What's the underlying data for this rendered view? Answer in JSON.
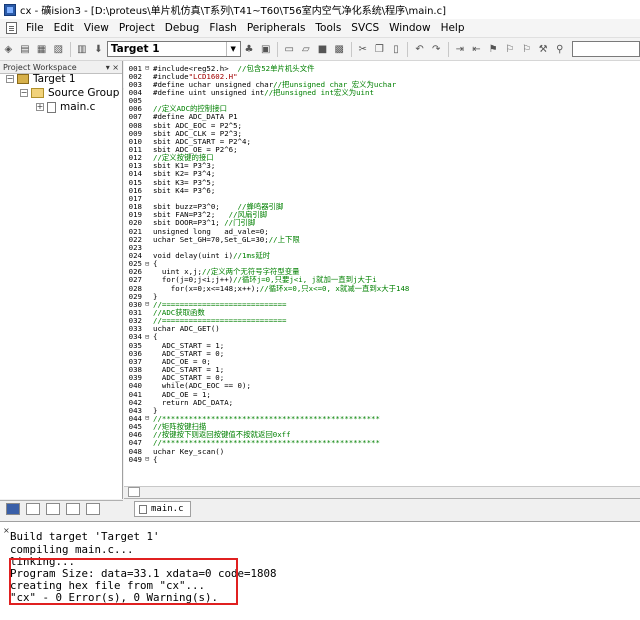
{
  "window": {
    "title": "cx - 礦ision3 - [D:\\proteus\\单片机仿真\\T系列\\T41~T60\\T56室内空气净化系统\\程序\\main.c]"
  },
  "menu": [
    "File",
    "Edit",
    "View",
    "Project",
    "Debug",
    "Flash",
    "Peripherals",
    "Tools",
    "SVCS",
    "Window",
    "Help"
  ],
  "toolbar": {
    "target": "Target 1"
  },
  "project_panel": {
    "header": "Project Workspace",
    "header_controls": "▾ ×",
    "tree": {
      "target": "Target 1",
      "group": "Source Group 1",
      "file": "main.c"
    }
  },
  "editor": {
    "tab": "main.c",
    "lines": [
      {
        "n": "001",
        "f": "⊟",
        "parts": [
          [
            "code",
            "#include<reg52.h>  "
          ],
          [
            "cmt",
            "//包含52单片机头文件"
          ]
        ]
      },
      {
        "n": "002",
        "f": "",
        "parts": [
          [
            "code",
            "#include"
          ],
          [
            "str",
            "\"LCD1602.H\""
          ]
        ]
      },
      {
        "n": "003",
        "f": "",
        "parts": [
          [
            "code",
            "#define uchar unsigned char"
          ],
          [
            "cmt",
            "//把unsigned char 宏义为uchar"
          ]
        ]
      },
      {
        "n": "004",
        "f": "",
        "parts": [
          [
            "code",
            "#define uint unsigned int"
          ],
          [
            "cmt",
            "//把unsigned int宏义为uint"
          ]
        ]
      },
      {
        "n": "005",
        "f": "",
        "parts": [
          [
            "code",
            ""
          ]
        ]
      },
      {
        "n": "006",
        "f": "",
        "parts": [
          [
            "cmt",
            "//定义ADC的控制接口"
          ]
        ]
      },
      {
        "n": "007",
        "f": "",
        "parts": [
          [
            "code",
            "#define ADC_DATA P1"
          ]
        ]
      },
      {
        "n": "008",
        "f": "",
        "parts": [
          [
            "code",
            "sbit ADC_EOC = P2^5;"
          ]
        ]
      },
      {
        "n": "009",
        "f": "",
        "parts": [
          [
            "code",
            "sbit ADC_CLK = P2^3;"
          ]
        ]
      },
      {
        "n": "010",
        "f": "",
        "parts": [
          [
            "code",
            "sbit ADC_START = P2^4;"
          ]
        ]
      },
      {
        "n": "011",
        "f": "",
        "parts": [
          [
            "code",
            "sbit ADC_OE = P2^6;"
          ]
        ]
      },
      {
        "n": "012",
        "f": "",
        "parts": [
          [
            "cmt",
            "//定义按键的接口"
          ]
        ]
      },
      {
        "n": "013",
        "f": "",
        "parts": [
          [
            "code",
            "sbit K1= P3^3;"
          ]
        ]
      },
      {
        "n": "014",
        "f": "",
        "parts": [
          [
            "code",
            "sbit K2= P3^4;"
          ]
        ]
      },
      {
        "n": "015",
        "f": "",
        "parts": [
          [
            "code",
            "sbit K3= P3^5;"
          ]
        ]
      },
      {
        "n": "016",
        "f": "",
        "parts": [
          [
            "code",
            "sbit K4= P3^6;"
          ]
        ]
      },
      {
        "n": "017",
        "f": "",
        "parts": [
          [
            "code",
            ""
          ]
        ]
      },
      {
        "n": "018",
        "f": "",
        "parts": [
          [
            "code",
            "sbit buzz=P3^0;    "
          ],
          [
            "cmt",
            "//蜂鸣器引脚"
          ]
        ]
      },
      {
        "n": "019",
        "f": "",
        "parts": [
          [
            "code",
            "sbit FAN=P3^2;   "
          ],
          [
            "cmt",
            "//风扇引脚"
          ]
        ]
      },
      {
        "n": "020",
        "f": "",
        "parts": [
          [
            "code",
            "sbit DOOR=P3^1; "
          ],
          [
            "cmt",
            "//门引脚"
          ]
        ]
      },
      {
        "n": "021",
        "f": "",
        "parts": [
          [
            "code",
            "unsigned long   ad_vale=0;"
          ]
        ]
      },
      {
        "n": "022",
        "f": "",
        "parts": [
          [
            "code",
            "uchar Set_GH=70,Set_GL=30;"
          ],
          [
            "cmt",
            "//上下限"
          ]
        ]
      },
      {
        "n": "023",
        "f": "",
        "parts": [
          [
            "code",
            ""
          ]
        ]
      },
      {
        "n": "024",
        "f": "",
        "parts": [
          [
            "code",
            "void delay(uint i)"
          ],
          [
            "cmt",
            "//1ms延时"
          ]
        ]
      },
      {
        "n": "025",
        "f": "⊟",
        "parts": [
          [
            "code",
            "{"
          ]
        ]
      },
      {
        "n": "026",
        "f": "",
        "parts": [
          [
            "code",
            "  uint x,j;"
          ],
          [
            "cmt",
            "//定义两个无符号字符型变量"
          ]
        ]
      },
      {
        "n": "027",
        "f": "",
        "parts": [
          [
            "code",
            "  for(j=0;j<i;j++)"
          ],
          [
            "cmt",
            "//循环j=0,只要j<i, j就加一直到j大于i"
          ]
        ]
      },
      {
        "n": "028",
        "f": "",
        "parts": [
          [
            "code",
            "    for(x=0;x<=148;x++);"
          ],
          [
            "cmt",
            "//循环x=0,只x<=0, x就减一直到x大于148"
          ]
        ]
      },
      {
        "n": "029",
        "f": "",
        "parts": [
          [
            "code",
            "}"
          ]
        ]
      },
      {
        "n": "030",
        "f": "⊟",
        "parts": [
          [
            "cmt",
            "//============================"
          ]
        ]
      },
      {
        "n": "031",
        "f": "",
        "parts": [
          [
            "cmt",
            "//ADC获取函数"
          ]
        ]
      },
      {
        "n": "032",
        "f": "",
        "parts": [
          [
            "cmt",
            "//============================"
          ]
        ]
      },
      {
        "n": "033",
        "f": "",
        "parts": [
          [
            "code",
            "uchar ADC_GET()"
          ]
        ]
      },
      {
        "n": "034",
        "f": "⊟",
        "parts": [
          [
            "code",
            "{"
          ]
        ]
      },
      {
        "n": "035",
        "f": "",
        "parts": [
          [
            "code",
            "  ADC_START = 1;"
          ]
        ]
      },
      {
        "n": "036",
        "f": "",
        "parts": [
          [
            "code",
            "  ADC_START = 0;"
          ]
        ]
      },
      {
        "n": "037",
        "f": "",
        "parts": [
          [
            "code",
            "  ADC_OE = 0;"
          ]
        ]
      },
      {
        "n": "038",
        "f": "",
        "parts": [
          [
            "code",
            "  ADC_START = 1;"
          ]
        ]
      },
      {
        "n": "039",
        "f": "",
        "parts": [
          [
            "code",
            "  ADC_START = 0;"
          ]
        ]
      },
      {
        "n": "040",
        "f": "",
        "parts": [
          [
            "code",
            "  while(ADC_EOC == 0);"
          ]
        ]
      },
      {
        "n": "041",
        "f": "",
        "parts": [
          [
            "code",
            "  ADC_OE = 1;"
          ]
        ]
      },
      {
        "n": "042",
        "f": "",
        "parts": [
          [
            "code",
            "  return ADC_DATA;"
          ]
        ]
      },
      {
        "n": "043",
        "f": "",
        "parts": [
          [
            "code",
            "}"
          ]
        ]
      },
      {
        "n": "044",
        "f": "⊟",
        "parts": [
          [
            "cmt",
            "//*************************************************"
          ]
        ]
      },
      {
        "n": "045",
        "f": "",
        "parts": [
          [
            "cmt",
            "//矩阵按键扫描"
          ]
        ]
      },
      {
        "n": "046",
        "f": "",
        "parts": [
          [
            "cmt",
            "//按键按下则返回按键值不按就返回0xff"
          ]
        ]
      },
      {
        "n": "047",
        "f": "",
        "parts": [
          [
            "cmt",
            "//*************************************************"
          ]
        ]
      },
      {
        "n": "048",
        "f": "",
        "parts": [
          [
            "code",
            "uchar Key_scan()"
          ]
        ]
      },
      {
        "n": "049",
        "f": "⊟",
        "parts": [
          [
            "code",
            "{"
          ]
        ]
      }
    ]
  },
  "output": {
    "lines": [
      "Build target 'Target 1'",
      "compiling main.c...",
      "linking...",
      "Program Size: data=33.1 xdata=0 code=1808",
      "creating hex file from \"cx\"...",
      "\"cx\" - 0 Error(s), 0 Warning(s)."
    ],
    "highlight_color": "#e02020"
  }
}
